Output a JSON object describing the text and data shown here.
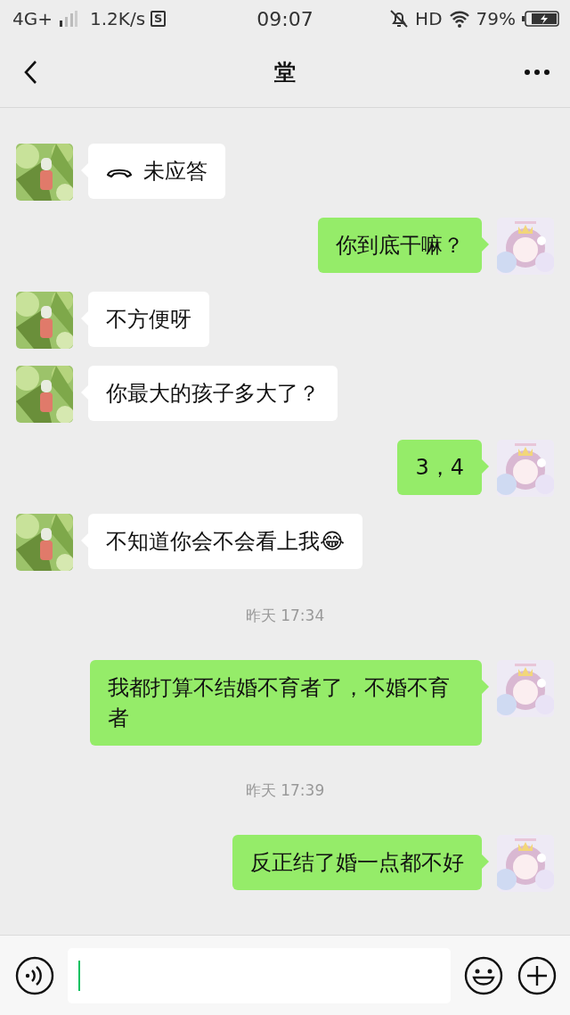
{
  "status_bar": {
    "network": "4G+",
    "speed": "1.2K/s",
    "app_badge": "S",
    "time": "09:07",
    "hd": "HD",
    "battery": "79%"
  },
  "header": {
    "title": "堂"
  },
  "messages": [
    {
      "kind": "call",
      "outgoing": false,
      "text": "未应答"
    },
    {
      "kind": "text",
      "outgoing": true,
      "text": "你到底干嘛？"
    },
    {
      "kind": "text",
      "outgoing": false,
      "text": "不方便呀"
    },
    {
      "kind": "text",
      "outgoing": false,
      "text": "你最大的孩子多大了？"
    },
    {
      "kind": "text",
      "outgoing": true,
      "text": "3，4"
    },
    {
      "kind": "text",
      "outgoing": false,
      "text": "不知道你会不会看上我😂"
    },
    {
      "kind": "time",
      "text": "昨天 17:34"
    },
    {
      "kind": "text",
      "outgoing": true,
      "text": "我都打算不结婚不育者了，不婚不育者"
    },
    {
      "kind": "time",
      "text": "昨天 17:39"
    },
    {
      "kind": "text",
      "outgoing": true,
      "text": "反正结了婚一点都不好"
    }
  ]
}
